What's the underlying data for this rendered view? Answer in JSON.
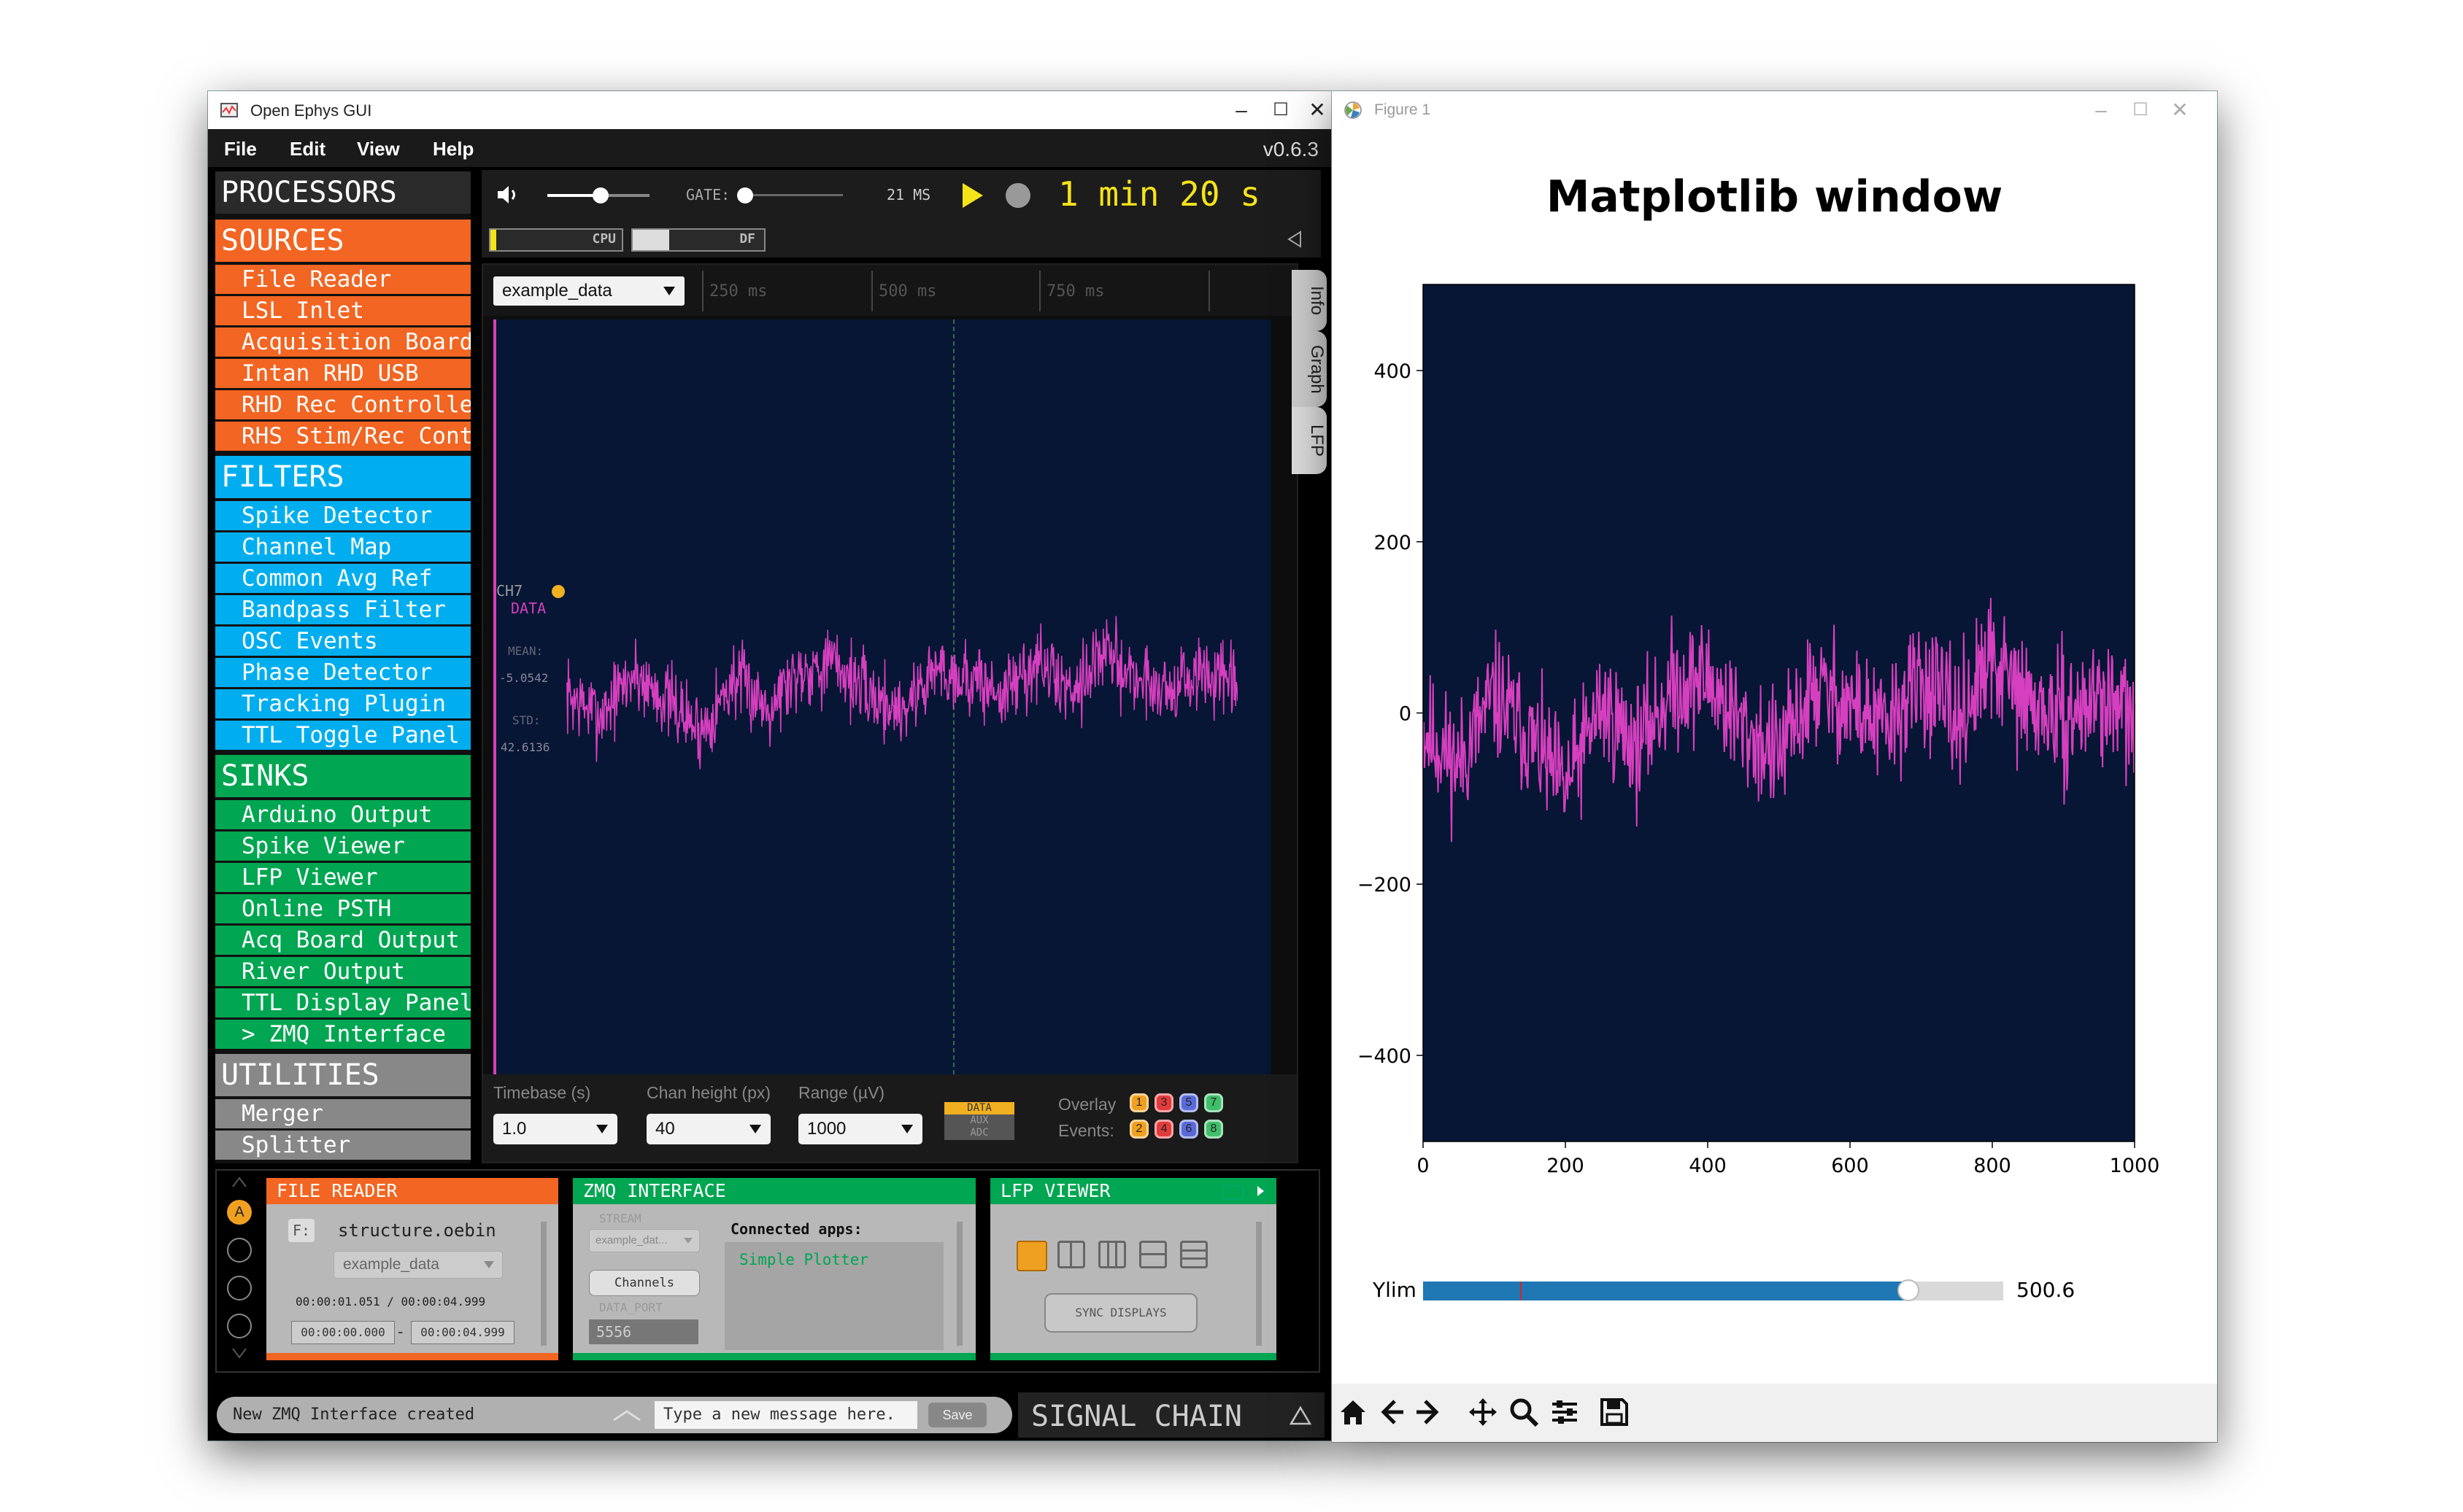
{
  "open_ephys": {
    "window_title": "Open Ephys GUI",
    "menu": [
      "File",
      "Edit",
      "View",
      "Help"
    ],
    "version": "v0.6.3",
    "window_controls": [
      "–",
      "☐",
      "✕"
    ],
    "processors_title": "PROCESSORS",
    "categories": [
      {
        "name": "SOURCES",
        "color": "#f26522",
        "items": [
          "File Reader",
          "LSL Inlet",
          "Acquisition Board",
          "Intan RHD USB",
          "RHD Rec Controller",
          "RHS Stim/Rec Controller"
        ]
      },
      {
        "name": "FILTERS",
        "color": "#00aeef",
        "items": [
          "Spike Detector",
          "Channel Map",
          "Common Avg Ref",
          "Bandpass Filter",
          "OSC Events",
          "Phase Detector",
          "Tracking Plugin",
          "TTL Toggle Panel"
        ]
      },
      {
        "name": "SINKS",
        "color": "#00a651",
        "items": [
          "Arduino Output",
          "Spike Viewer",
          "LFP Viewer",
          "Online PSTH",
          "Acq Board Output",
          "River Output",
          "TTL Display Panel",
          "> ZMQ Interface"
        ]
      },
      {
        "name": "UTILITIES",
        "color": "#888888",
        "items": [
          "Merger",
          "Splitter"
        ]
      }
    ],
    "control": {
      "gate_label": "GATE:",
      "latency": "21 MS",
      "clock": "1 min 20 s",
      "cpu_label": "CPU",
      "df_label": "DF",
      "clock_color": "#f5e31a"
    },
    "lfp": {
      "stream_select": "example_data",
      "time_markers": [
        "250 ms",
        "500 ms",
        "750 ms"
      ],
      "tabs": [
        "Info",
        "Graph",
        "LFP"
      ],
      "channel": "CH7",
      "channel_type": "DATA",
      "mean_label": "MEAN:",
      "mean_value": "-5.0542",
      "std_label": "STD:",
      "std_value": "42.6136",
      "controls": [
        {
          "label": "Timebase (s)",
          "value": "1.0"
        },
        {
          "label": "Chan height (px)",
          "value": "40"
        },
        {
          "label": "Range (µV)",
          "value": "1000"
        }
      ],
      "data_toggle": [
        "DATA",
        "AUX",
        "ADC"
      ],
      "overlay_label": "Overlay",
      "events_label": "Events:",
      "event_numbers": [
        "1",
        "3",
        "5",
        "7",
        "2",
        "4",
        "6",
        "8"
      ]
    },
    "editors": {
      "file_reader": {
        "title": "FILE READER",
        "drive": "F:",
        "file": "structure.oebin",
        "stream": "example_data",
        "time_range": "00:00:01.051 / 00:00:04.999",
        "start": "00:00:00.000",
        "end": "00:00:04.999",
        "dash": "-"
      },
      "zmq": {
        "title": "ZMQ INTERFACE",
        "stream_label": "STREAM",
        "stream_value": "example_dat...",
        "channels_button": "Channels",
        "port_label": "DATA_PORT",
        "port_value": "5556",
        "connected_label": "Connected apps:",
        "app": "Simple Plotter"
      },
      "lfp_viewer": {
        "title": "LFP VIEWER",
        "sync_button": "SYNC DISPLAYS"
      }
    },
    "chain_tabs": [
      "A"
    ],
    "status_message": "New ZMQ Interface created",
    "message_placeholder": "Type a new message here.",
    "save_button": "Save",
    "signal_chain_label": "SIGNAL CHAIN"
  },
  "matplotlib": {
    "window_title": "Figure 1",
    "window_controls": [
      "–",
      "☐",
      "✕"
    ],
    "slider": {
      "label": "Ylim",
      "value_text": "500.6",
      "min": 0,
      "max": 600,
      "value": 500.6,
      "valinit": 100
    },
    "toolbar": [
      "home-icon",
      "back-icon",
      "forward-icon",
      "pan-icon",
      "zoom-icon",
      "configure-icon",
      "save-icon"
    ]
  },
  "chart_data": {
    "type": "line",
    "title": "Matplotlib window",
    "xlabel": "",
    "ylabel": "",
    "xlim": [
      0,
      1000
    ],
    "ylim": [
      -500.6,
      500.6
    ],
    "xticks": [
      "0",
      "200",
      "400",
      "600",
      "800",
      "1000"
    ],
    "yticks": [
      "400",
      "200",
      "0",
      "−200",
      "−400"
    ],
    "ytick_values": [
      400,
      200,
      0,
      -200,
      -400
    ],
    "xtick_values": [
      0,
      200,
      400,
      600,
      800,
      1000
    ],
    "background": "#061634",
    "line_color": "#d63fbf",
    "samples": 1000,
    "envelope": [
      {
        "x": 0,
        "y": -20
      },
      {
        "x": 50,
        "y": -60
      },
      {
        "x": 100,
        "y": 20
      },
      {
        "x": 150,
        "y": -30
      },
      {
        "x": 200,
        "y": -90
      },
      {
        "x": 250,
        "y": 10
      },
      {
        "x": 300,
        "y": -40
      },
      {
        "x": 350,
        "y": 30
      },
      {
        "x": 400,
        "y": 40
      },
      {
        "x": 450,
        "y": -20
      },
      {
        "x": 500,
        "y": -50
      },
      {
        "x": 550,
        "y": 30
      },
      {
        "x": 600,
        "y": 10
      },
      {
        "x": 650,
        "y": -20
      },
      {
        "x": 700,
        "y": 40
      },
      {
        "x": 750,
        "y": -10
      },
      {
        "x": 800,
        "y": 60
      },
      {
        "x": 850,
        "y": 10
      },
      {
        "x": 900,
        "y": -10
      },
      {
        "x": 950,
        "y": 20
      },
      {
        "x": 1000,
        "y": -10
      }
    ],
    "noise_amplitude": 45
  }
}
